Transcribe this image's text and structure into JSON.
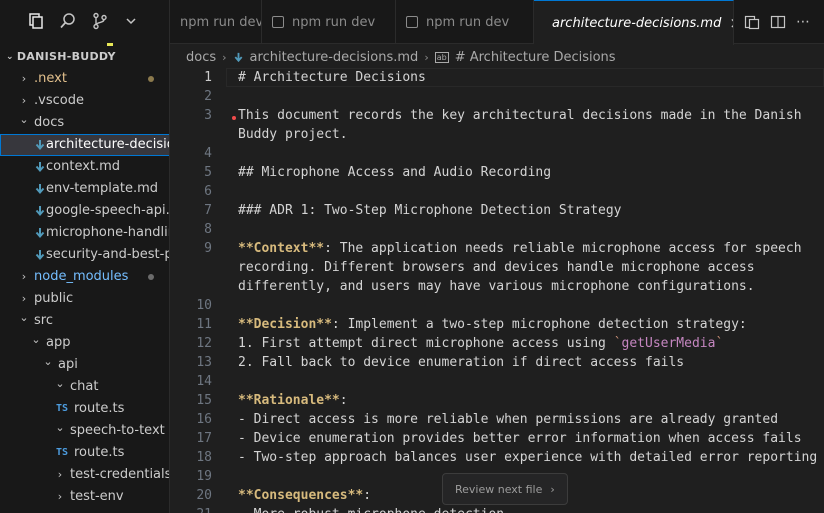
{
  "sidebar": {
    "title": "DANISH-BUDDY",
    "items": [
      {
        "label": ".next",
        "kind": "folder",
        "depth": 0,
        "expanded": false,
        "color": "#e2c08d",
        "dot": "#8c7a4d"
      },
      {
        "label": ".vscode",
        "kind": "folder",
        "depth": 0,
        "expanded": false,
        "color": "#cccccc"
      },
      {
        "label": "docs",
        "kind": "folder",
        "depth": 0,
        "expanded": true,
        "color": "#cccccc"
      },
      {
        "label": "architecture-decisio...",
        "kind": "md",
        "depth": 1,
        "selected": true,
        "color": "#ffffff"
      },
      {
        "label": "context.md",
        "kind": "md",
        "depth": 1,
        "color": "#cccccc"
      },
      {
        "label": "env-template.md",
        "kind": "md",
        "depth": 1,
        "color": "#cccccc"
      },
      {
        "label": "google-speech-api....",
        "kind": "md",
        "depth": 1,
        "color": "#cccccc"
      },
      {
        "label": "microphone-handlin...",
        "kind": "md",
        "depth": 1,
        "color": "#cccccc"
      },
      {
        "label": "security-and-best-pr...",
        "kind": "md",
        "depth": 1,
        "color": "#cccccc"
      },
      {
        "label": "node_modules",
        "kind": "folder",
        "depth": 0,
        "expanded": false,
        "color": "#75beff",
        "dot": "#6b6b6b"
      },
      {
        "label": "public",
        "kind": "folder",
        "depth": 0,
        "expanded": false,
        "color": "#cccccc"
      },
      {
        "label": "src",
        "kind": "folder",
        "depth": 0,
        "expanded": true,
        "color": "#cccccc"
      },
      {
        "label": "app",
        "kind": "folder",
        "depth": 1,
        "expanded": true,
        "color": "#cccccc"
      },
      {
        "label": "api",
        "kind": "folder",
        "depth": 2,
        "expanded": true,
        "color": "#cccccc"
      },
      {
        "label": "chat",
        "kind": "folder",
        "depth": 3,
        "expanded": true,
        "color": "#cccccc"
      },
      {
        "label": "route.ts",
        "kind": "ts",
        "depth": 4,
        "color": "#cccccc"
      },
      {
        "label": "speech-to-text",
        "kind": "folder",
        "depth": 3,
        "expanded": true,
        "color": "#cccccc"
      },
      {
        "label": "route.ts",
        "kind": "ts",
        "depth": 4,
        "color": "#cccccc"
      },
      {
        "label": "test-credentials",
        "kind": "folder",
        "depth": 3,
        "expanded": false,
        "color": "#cccccc"
      },
      {
        "label": "test-env",
        "kind": "folder",
        "depth": 3,
        "expanded": false,
        "color": "#cccccc"
      }
    ]
  },
  "tabs": [
    {
      "label": "npm run dev",
      "active": false
    },
    {
      "label": "npm run dev",
      "active": false
    },
    {
      "label": "npm run dev",
      "active": false
    },
    {
      "label": "architecture-decisions.md",
      "active": true,
      "close": "×"
    }
  ],
  "breadcrumb": {
    "folder": "docs",
    "file": "architecture-decisions.md",
    "symbol": "# Architecture Decisions"
  },
  "editor": {
    "current_line": 1,
    "lines": [
      {
        "n": "1",
        "parts": [
          {
            "t": "# Architecture Decisions"
          }
        ]
      },
      {
        "n": "2",
        "parts": []
      },
      {
        "n": "3",
        "parts": [
          {
            "t": "This document records the key architectural decisions made in the Danish"
          }
        ]
      },
      {
        "n": "",
        "parts": [
          {
            "t": "Buddy project."
          }
        ]
      },
      {
        "n": "4",
        "parts": []
      },
      {
        "n": "5",
        "parts": [
          {
            "t": "## Microphone Access and Audio Recording"
          }
        ]
      },
      {
        "n": "6",
        "parts": []
      },
      {
        "n": "7",
        "parts": [
          {
            "t": "### ADR 1: Two-Step Microphone Detection Strategy"
          }
        ]
      },
      {
        "n": "8",
        "parts": []
      },
      {
        "n": "9",
        "parts": [
          {
            "t": "**Context**",
            "s": "bold"
          },
          {
            "t": ": The application needs reliable microphone access for speech"
          }
        ]
      },
      {
        "n": "",
        "parts": [
          {
            "t": "recording. Different browsers and devices handle microphone access"
          }
        ]
      },
      {
        "n": "",
        "parts": [
          {
            "t": "differently, and users may have various microphone configurations."
          }
        ]
      },
      {
        "n": "10",
        "parts": []
      },
      {
        "n": "11",
        "parts": [
          {
            "t": "**Decision**",
            "s": "bold"
          },
          {
            "t": ": Implement a two-step microphone detection strategy:"
          }
        ]
      },
      {
        "n": "12",
        "parts": [
          {
            "t": "1. First attempt direct microphone access using "
          },
          {
            "t": "`",
            "s": "tick"
          },
          {
            "t": "getUserMedia",
            "s": "fn"
          },
          {
            "t": "`",
            "s": "tick"
          }
        ]
      },
      {
        "n": "13",
        "parts": [
          {
            "t": "2. Fall back to device enumeration if direct access fails"
          }
        ]
      },
      {
        "n": "14",
        "parts": []
      },
      {
        "n": "15",
        "parts": [
          {
            "t": "**Rationale**",
            "s": "bold"
          },
          {
            "t": ":"
          }
        ]
      },
      {
        "n": "16",
        "parts": [
          {
            "t": "- Direct access is more reliable when permissions are already granted"
          }
        ]
      },
      {
        "n": "17",
        "parts": [
          {
            "t": "- Device enumeration provides better error information when access fails"
          }
        ]
      },
      {
        "n": "18",
        "parts": [
          {
            "t": "- Two-step approach balances user experience with detailed error reporting"
          }
        ]
      },
      {
        "n": "19",
        "parts": []
      },
      {
        "n": "20",
        "parts": [
          {
            "t": "**Consequences**",
            "s": "bold"
          },
          {
            "t": ":"
          }
        ]
      },
      {
        "n": "21",
        "parts": [
          {
            "t": "- More robust microphone detection"
          }
        ]
      }
    ]
  },
  "review_button": {
    "label": "Review next file",
    "chevron": "›"
  },
  "icons": {
    "explorer": "explorer-icon",
    "search": "search-icon",
    "source_control": "source-control-icon",
    "more": "chevron-down-icon"
  }
}
